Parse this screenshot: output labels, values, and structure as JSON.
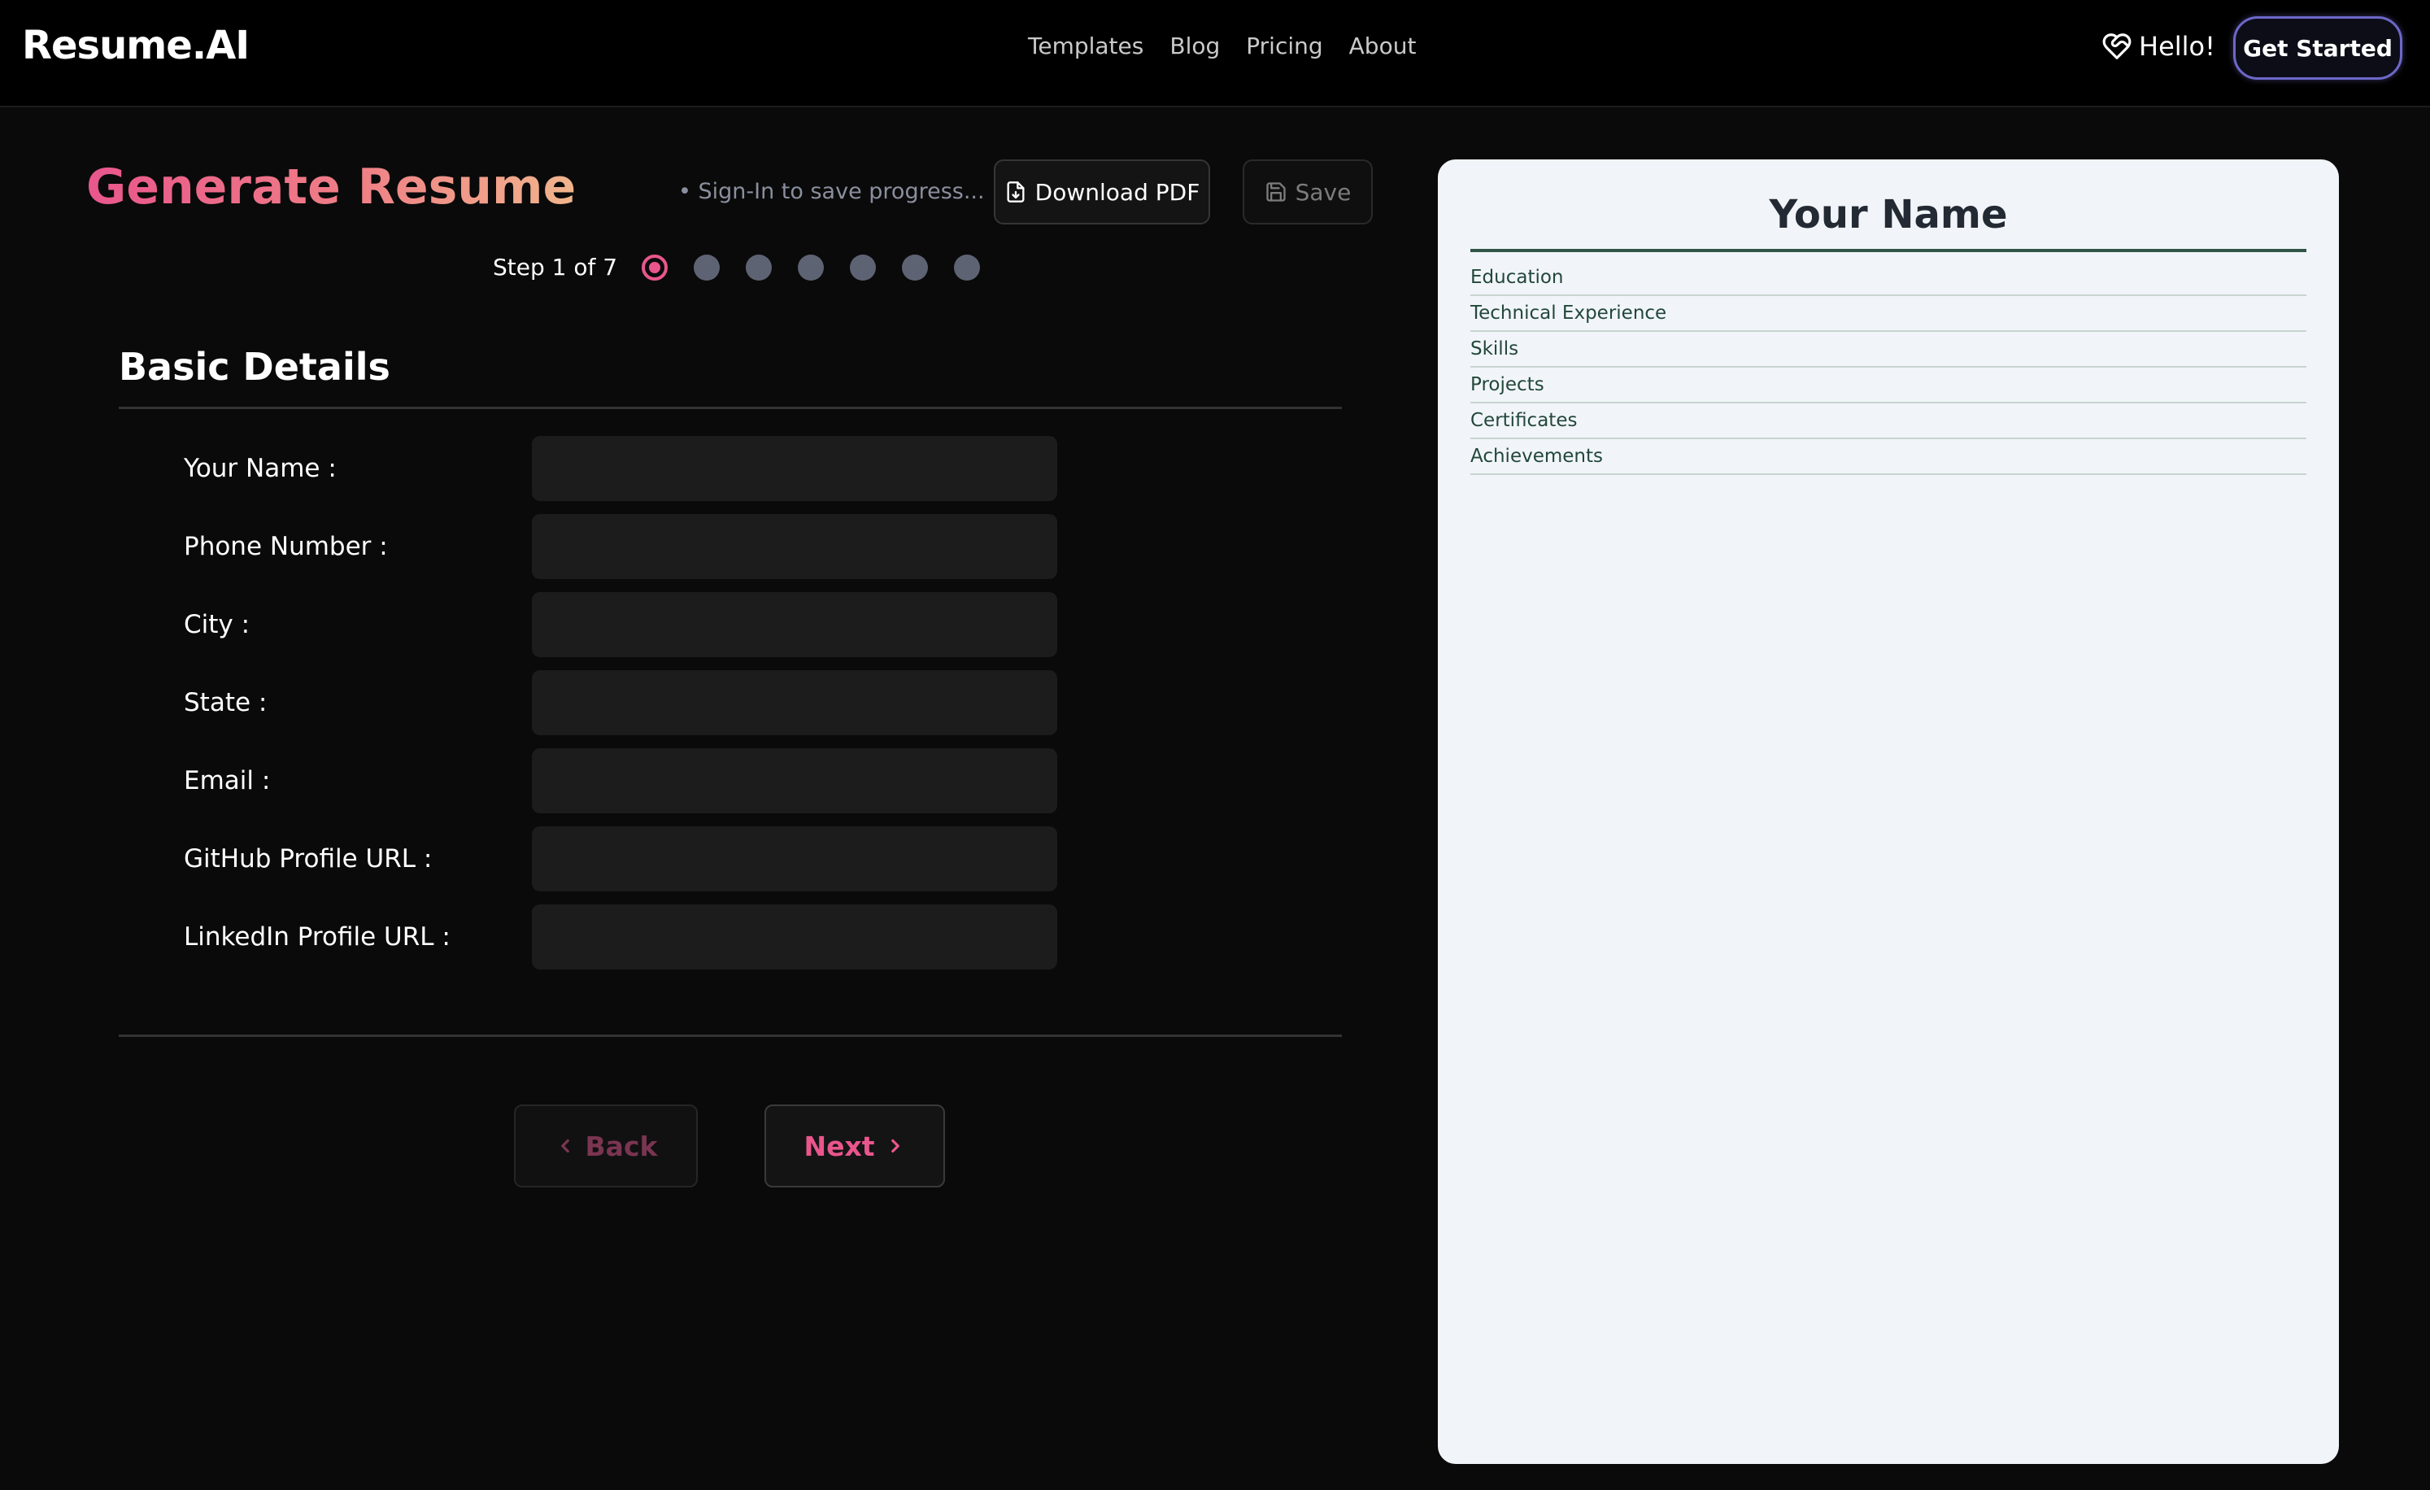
{
  "nav": {
    "logo": "Resume.AI",
    "links": [
      "Templates",
      "Blog",
      "Pricing",
      "About"
    ],
    "greeting": "Hello!",
    "cta": "Get Started"
  },
  "generator": {
    "title": "Generate Resume",
    "signin_note": "• Sign-In to save progress...",
    "download_label": "Download PDF",
    "save_label": "Save",
    "step_label": "Step 1 of 7",
    "current_step": 1,
    "total_steps": 7
  },
  "form": {
    "section_title": "Basic Details",
    "fields": [
      {
        "label": "Your Name :",
        "value": ""
      },
      {
        "label": "Phone Number :",
        "value": ""
      },
      {
        "label": "City :",
        "value": ""
      },
      {
        "label": "State :",
        "value": ""
      },
      {
        "label": "Email :",
        "value": ""
      },
      {
        "label": "GitHub Profile URL :",
        "value": ""
      },
      {
        "label": "LinkedIn Profile URL :",
        "value": ""
      }
    ],
    "back_label": "Back",
    "next_label": "Next"
  },
  "preview": {
    "name": "Your Name",
    "sections": [
      "Education",
      "Technical Experience",
      "Skills",
      "Projects",
      "Certificates",
      "Achievements"
    ]
  },
  "colors": {
    "accent": "#e9568c",
    "title_gradient": [
      "#e9568c",
      "#f0b58c"
    ],
    "cta_border": "#6c68c9",
    "preview_rule": "#2f5546"
  }
}
